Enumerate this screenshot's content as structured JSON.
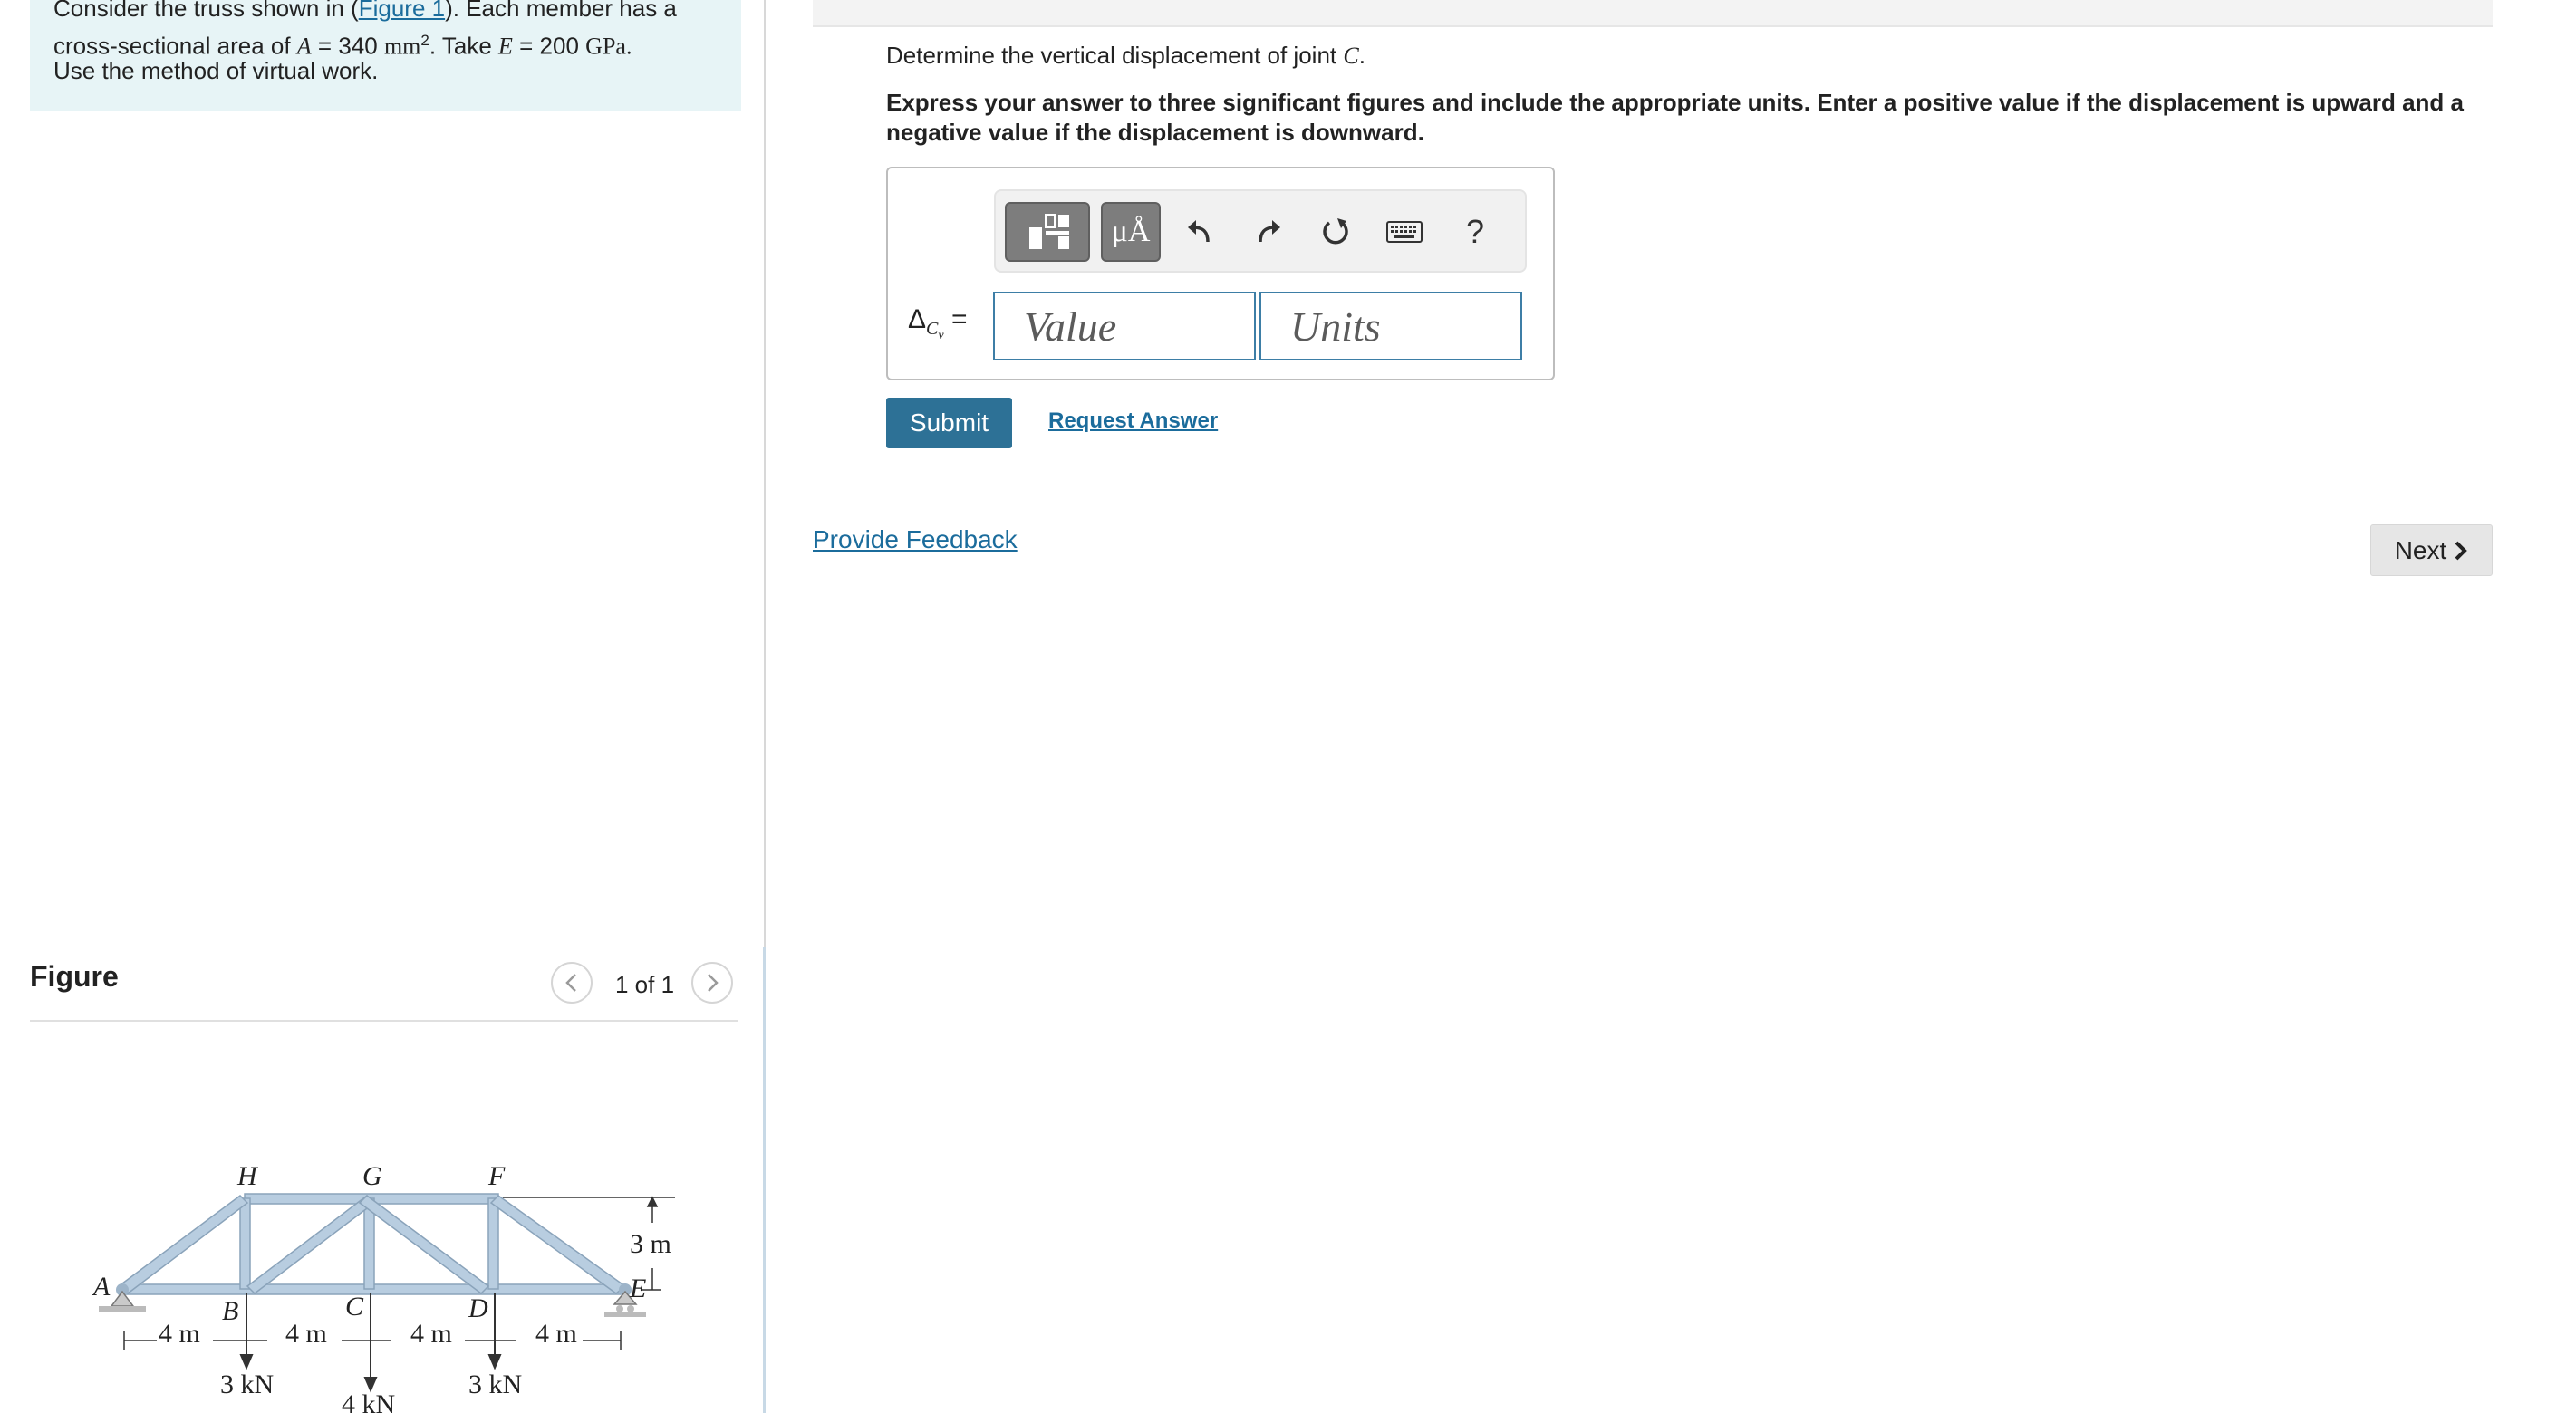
{
  "problem": {
    "line1_prefix": "Consider the truss shown in (",
    "figure_link": "Figure 1",
    "line1_suffix": "). Each member has a",
    "line2_prefix": "cross-sectional area of",
    "area_symbol": "A",
    "area_value": "= 340",
    "area_unit": "mm",
    "area_exp": "2",
    "take": ". Take",
    "e_symbol": "E",
    "e_value": "= 200",
    "e_unit": "GPa.",
    "line3": "Use the method of virtual work."
  },
  "figure": {
    "title": "Figure",
    "pager": "1 of 1",
    "labels": {
      "H": "H",
      "G": "G",
      "F": "F",
      "A": "A",
      "B": "B",
      "C": "C",
      "D": "D",
      "E": "E",
      "dim1": "4 m",
      "dim2": "4 m",
      "dim3": "4 m",
      "dim4": "4 m",
      "height": "3 m",
      "load_b": "3 kN",
      "load_c": "4 kN",
      "load_d": "3 kN"
    }
  },
  "question": {
    "prefix": "Determine the vertical displacement of joint",
    "joint": "C",
    "period": ".",
    "instructions": "Express your answer to three significant figures and include the appropriate units. Enter a positive value if the displacement is upward and a negative value if the displacement is downward."
  },
  "answer": {
    "delta": "Δ",
    "sub_main": "C",
    "sub_sub": "v",
    "equals": "=",
    "value_placeholder": "Value",
    "units_placeholder": "Units",
    "symbols_label": "μÅ",
    "help_label": "?"
  },
  "actions": {
    "submit": "Submit",
    "request_answer": "Request Answer",
    "provide_feedback": "Provide Feedback",
    "next": "Next"
  },
  "colors": {
    "problem_bg": "#e7f4f6",
    "link": "#1b6c9c",
    "submit_bg": "#2d7196",
    "input_border": "#3d7ea6",
    "truss_member": "#b3c8dc"
  },
  "icons": [
    "templates-icon",
    "undo-icon",
    "redo-icon",
    "reset-icon",
    "keyboard-icon",
    "chevron-left-icon",
    "chevron-right-icon"
  ]
}
